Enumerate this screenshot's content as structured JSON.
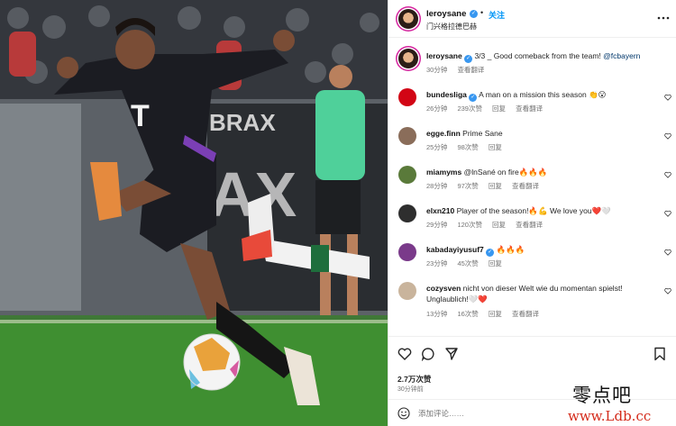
{
  "header": {
    "username": "leroysane",
    "follow_label": "关注",
    "separator": "•",
    "location": "门兴格拉德巴赫"
  },
  "caption": {
    "username": "leroysane",
    "text": "3/3 _ Good comeback from the team! ",
    "mention": "@fcbayern",
    "time": "30分钟",
    "translate": "查看翻译"
  },
  "comments": [
    {
      "user": "bundesliga",
      "verified": true,
      "text": "A man on a mission this season 👏😮",
      "time": "26分钟",
      "likes": "239次赞",
      "reply": "回复",
      "translate": "查看翻译",
      "avatar_color": "#d20515"
    },
    {
      "user": "egge.finn",
      "verified": false,
      "text": "Prime Sane",
      "time": "25分钟",
      "likes": "98次赞",
      "reply": "回复",
      "translate": "",
      "avatar_color": "#8a6d5a"
    },
    {
      "user": "miamyms",
      "verified": false,
      "text": "@lnSané on fire🔥🔥🔥",
      "time": "28分钟",
      "likes": "97次赞",
      "reply": "回复",
      "translate": "查看翻译",
      "avatar_color": "#5a7a3a"
    },
    {
      "user": "elxn210",
      "verified": false,
      "text": "Player of the season!🔥💪 We love you❤️🤍",
      "time": "29分钟",
      "likes": "120次赞",
      "reply": "回复",
      "translate": "查看翻译",
      "avatar_color": "#2e2e2e"
    },
    {
      "user": "kabadayiyusuf7",
      "verified": true,
      "text": "🔥🔥🔥",
      "time": "23分钟",
      "likes": "45次赞",
      "reply": "回复",
      "translate": "",
      "avatar_color": "#7a3a8a"
    },
    {
      "user": "cozysven",
      "verified": false,
      "text": "nicht von dieser Welt wie du momentan spielst! Unglaublich!🤍❤️",
      "time": "13分钟",
      "likes": "16次赞",
      "reply": "回复",
      "translate": "查看翻译",
      "avatar_color": "#c9b49c"
    }
  ],
  "footer": {
    "likes": "2.7万次赞",
    "ago": "30分钟前",
    "comment_placeholder": "添加评论……"
  },
  "watermark": {
    "line1": "零点吧",
    "line2": "www.Ldb.cc"
  },
  "icons": {
    "like": "heart-icon",
    "comment": "comment-icon",
    "share": "share-icon",
    "save": "bookmark-icon",
    "emoji": "emoji-icon"
  },
  "colors": {
    "accent": "#0095f6",
    "verified": "#3897f0",
    "heart_red": "#ed4956"
  }
}
